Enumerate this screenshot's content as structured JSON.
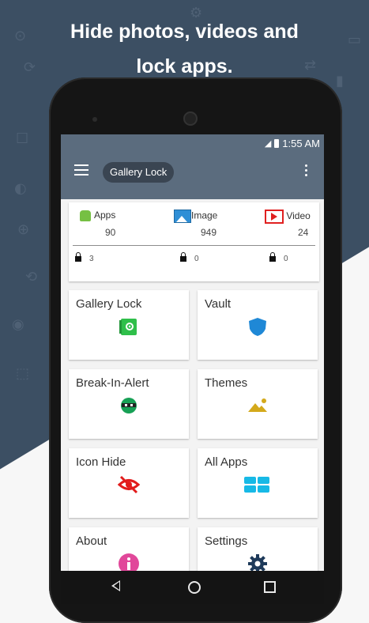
{
  "colors": {
    "bg_dark": "#3c4f63",
    "appbar": "#5b6c7e",
    "accent_green": "#76c043",
    "video_red": "#e02020"
  },
  "headline": {
    "line1": "Hide photos, videos and",
    "line2": "lock apps."
  },
  "status_bar": {
    "time": "1:55 AM"
  },
  "appbar": {
    "title": "Gallery Lock",
    "menu_icon": "hamburger-icon",
    "overflow_icon": "more-vert-icon"
  },
  "stats": [
    {
      "label": "Apps",
      "count": "90",
      "locked": "3",
      "icon": "android-icon"
    },
    {
      "label": "Image",
      "count": "949",
      "locked": "0",
      "icon": "image-icon"
    },
    {
      "label": "Video",
      "count": "24",
      "locked": "0",
      "icon": "video-icon"
    }
  ],
  "tiles": [
    {
      "label": "Gallery Lock",
      "icon": "safe-icon"
    },
    {
      "label": "Vault",
      "icon": "shield-icon"
    },
    {
      "label": "Break-In-Alert",
      "icon": "intruder-icon"
    },
    {
      "label": "Themes",
      "icon": "landscape-icon"
    },
    {
      "label": "Icon Hide",
      "icon": "eye-off-icon"
    },
    {
      "label": "All Apps",
      "icon": "apps-grid-icon"
    },
    {
      "label": "About",
      "icon": "info-icon"
    },
    {
      "label": "Settings",
      "icon": "gear-icon"
    }
  ],
  "navbar": {
    "back_icon": "back-icon",
    "home_icon": "home-icon",
    "recents_icon": "recents-icon"
  }
}
